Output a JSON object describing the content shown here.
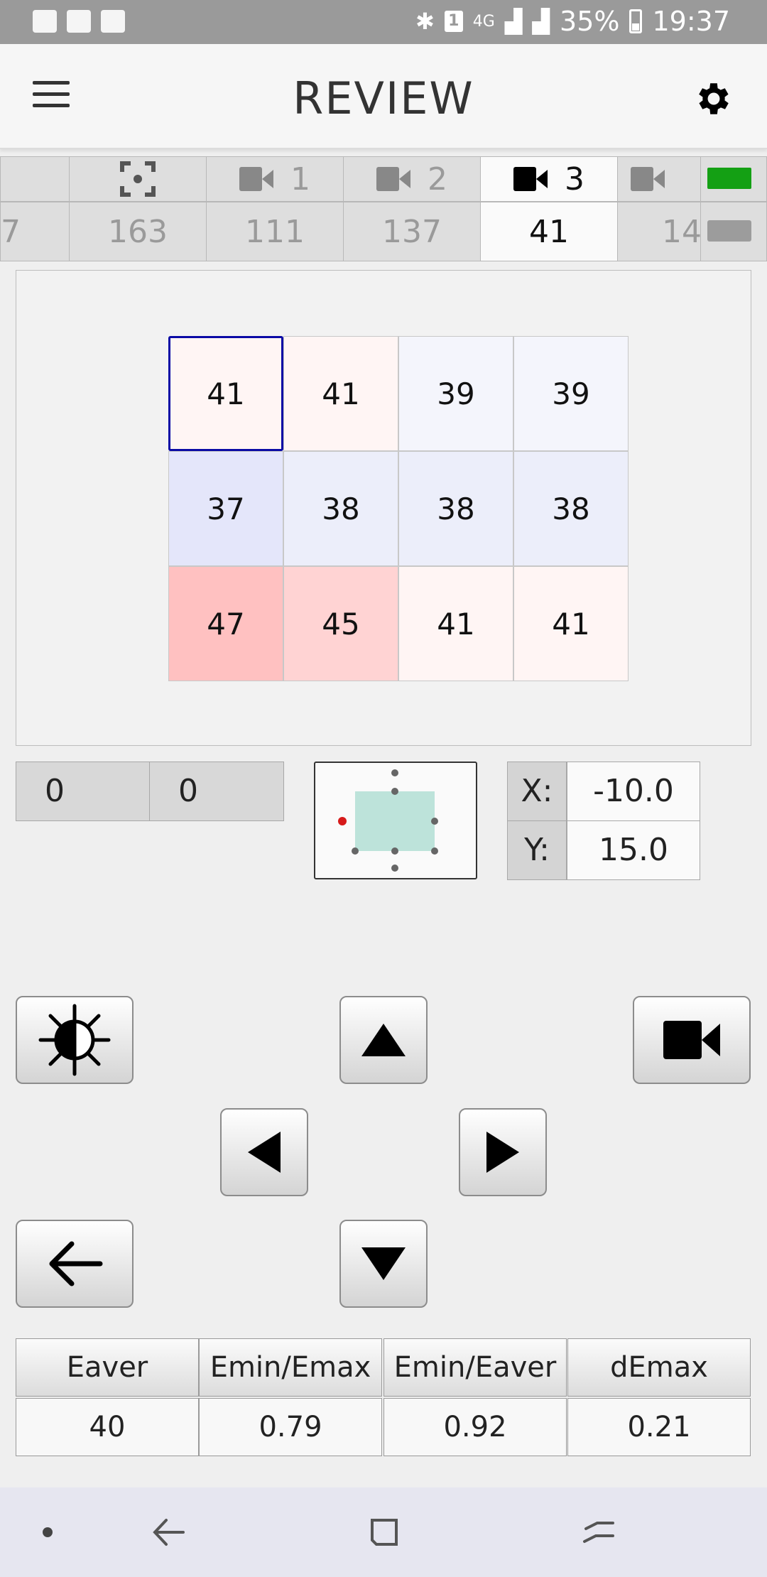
{
  "status_bar": {
    "battery_percent": "35%",
    "time": "19:37",
    "network_type": "4G",
    "sim_slot": "1",
    "left_icons": [
      "gallery-icon",
      "facebook-icon",
      "wifi-icon"
    ],
    "right_icons": [
      "bluetooth-icon",
      "sim-icon",
      "signal-icon",
      "battery-icon"
    ]
  },
  "app_bar": {
    "title": "REVIEW",
    "menu_icon": "hamburger-icon",
    "settings_icon": "gear-icon"
  },
  "tabs": [
    {
      "label": "",
      "value": "7",
      "icon": "none",
      "active": false
    },
    {
      "label": "",
      "value": "163",
      "icon": "focus-icon",
      "active": false
    },
    {
      "label": "1",
      "value": "111",
      "icon": "camera-icon",
      "active": false
    },
    {
      "label": "2",
      "value": "137",
      "icon": "camera-icon",
      "active": false
    },
    {
      "label": "3",
      "value": "41",
      "icon": "camera-icon",
      "active": true
    },
    {
      "label": "",
      "value": "14",
      "icon": "camera-icon",
      "active": false
    }
  ],
  "indicators": {
    "top_color": "#14a014",
    "bottom_color": "#9c9c9c"
  },
  "grid": {
    "rows": [
      [
        {
          "value": "41",
          "color": "#fff5f4"
        },
        {
          "value": "41",
          "color": "#fff5f4"
        },
        {
          "value": "39",
          "color": "#f4f5fc"
        },
        {
          "value": "39",
          "color": "#f4f5fc"
        }
      ],
      [
        {
          "value": "37",
          "color": "#e4e6fa"
        },
        {
          "value": "38",
          "color": "#eceefa"
        },
        {
          "value": "38",
          "color": "#eceefa"
        },
        {
          "value": "38",
          "color": "#eceefa"
        }
      ],
      [
        {
          "value": "47",
          "color": "#ffc1c1"
        },
        {
          "value": "45",
          "color": "#ffd3d3"
        },
        {
          "value": "41",
          "color": "#fff5f4"
        },
        {
          "value": "41",
          "color": "#fff5f4"
        }
      ]
    ],
    "selected": [
      0,
      0
    ]
  },
  "offsets": {
    "a": "0",
    "b": "0"
  },
  "position": {
    "x_label": "X:",
    "x_value": "-10.0",
    "y_label": "Y:",
    "y_value": "15.0"
  },
  "controls": {
    "brightness_icon": "brightness-icon",
    "up_icon": "arrow-up-icon",
    "down_icon": "arrow-down-icon",
    "left_icon": "arrow-left-icon",
    "right_icon": "arrow-right-icon",
    "camera_icon": "camera-icon",
    "back_icon": "back-arrow-icon"
  },
  "stats": {
    "headers": [
      "Eaver",
      "Emin/Emax",
      "Emin/Eaver",
      "dEmax"
    ],
    "values": [
      "40",
      "0.79",
      "0.92",
      "0.21"
    ]
  },
  "nav_bar": {
    "icons": [
      "dot-icon",
      "back-icon",
      "recents-icon",
      "overview-icon"
    ]
  }
}
